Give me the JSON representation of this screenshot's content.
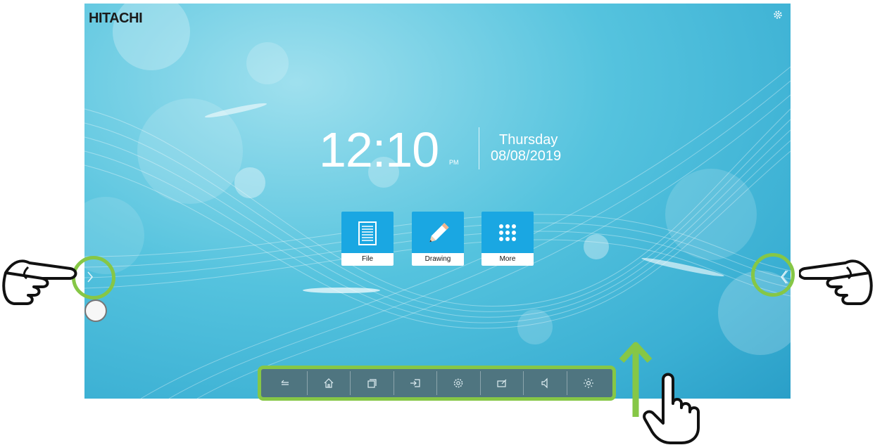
{
  "brand": "HITACHI",
  "clock": {
    "time": "12:10",
    "ampm": "PM",
    "day": "Thursday",
    "date": "08/08/2019"
  },
  "apps": [
    {
      "label": "File",
      "icon": "document-icon"
    },
    {
      "label": "Drawing",
      "icon": "pencil-icon"
    },
    {
      "label": "More",
      "icon": "grid-icon"
    }
  ],
  "taskbar": [
    {
      "icon": "back-icon"
    },
    {
      "icon": "home-icon"
    },
    {
      "icon": "recent-apps-icon"
    },
    {
      "icon": "input-source-icon"
    },
    {
      "icon": "settings-icon"
    },
    {
      "icon": "annotate-icon"
    },
    {
      "icon": "volume-icon"
    },
    {
      "icon": "brightness-icon"
    }
  ],
  "colors": {
    "highlight": "#86c746",
    "tile": "#1aa7e2",
    "taskbar": "#4f7580"
  }
}
